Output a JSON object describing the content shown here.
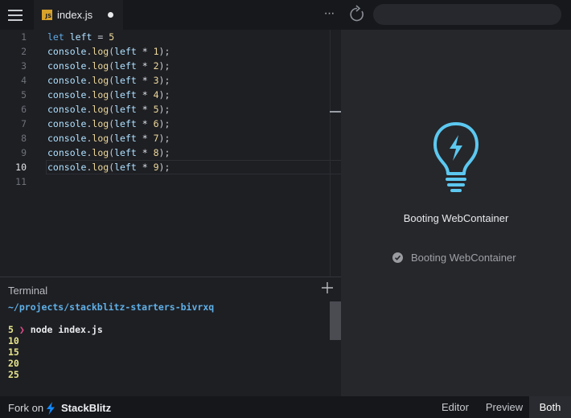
{
  "tab": {
    "filename": "index.js",
    "js_badge": "JS"
  },
  "toolbar": {
    "more": "···"
  },
  "editor": {
    "active_line": 10,
    "line_numbers": [
      "1",
      "2",
      "3",
      "4",
      "5",
      "6",
      "7",
      "8",
      "9",
      "10",
      "11"
    ],
    "lines": [
      [
        [
          "kw",
          "let"
        ],
        [
          "pn",
          " "
        ],
        [
          "id",
          "left"
        ],
        [
          "pn",
          " = "
        ],
        [
          "fn",
          "5"
        ]
      ],
      [
        [
          "id",
          "console"
        ],
        [
          "pn",
          "."
        ],
        [
          "fn",
          "log"
        ],
        [
          "pn",
          "("
        ],
        [
          "id",
          "left"
        ],
        [
          "op",
          " * "
        ],
        [
          "fn",
          "1"
        ],
        [
          "pn",
          ");"
        ]
      ],
      [
        [
          "id",
          "console"
        ],
        [
          "pn",
          "."
        ],
        [
          "fn",
          "log"
        ],
        [
          "pn",
          "("
        ],
        [
          "id",
          "left"
        ],
        [
          "op",
          " * "
        ],
        [
          "fn",
          "2"
        ],
        [
          "pn",
          ");"
        ]
      ],
      [
        [
          "id",
          "console"
        ],
        [
          "pn",
          "."
        ],
        [
          "fn",
          "log"
        ],
        [
          "pn",
          "("
        ],
        [
          "id",
          "left"
        ],
        [
          "op",
          " * "
        ],
        [
          "fn",
          "3"
        ],
        [
          "pn",
          ");"
        ]
      ],
      [
        [
          "id",
          "console"
        ],
        [
          "pn",
          "."
        ],
        [
          "fn",
          "log"
        ],
        [
          "pn",
          "("
        ],
        [
          "id",
          "left"
        ],
        [
          "op",
          " * "
        ],
        [
          "fn",
          "4"
        ],
        [
          "pn",
          ");"
        ]
      ],
      [
        [
          "id",
          "console"
        ],
        [
          "pn",
          "."
        ],
        [
          "fn",
          "log"
        ],
        [
          "pn",
          "("
        ],
        [
          "id",
          "left"
        ],
        [
          "op",
          " * "
        ],
        [
          "fn",
          "5"
        ],
        [
          "pn",
          ");"
        ]
      ],
      [
        [
          "id",
          "console"
        ],
        [
          "pn",
          "."
        ],
        [
          "fn",
          "log"
        ],
        [
          "pn",
          "("
        ],
        [
          "id",
          "left"
        ],
        [
          "op",
          " * "
        ],
        [
          "fn",
          "6"
        ],
        [
          "pn",
          ");"
        ]
      ],
      [
        [
          "id",
          "console"
        ],
        [
          "pn",
          "."
        ],
        [
          "fn",
          "log"
        ],
        [
          "pn",
          "("
        ],
        [
          "id",
          "left"
        ],
        [
          "op",
          " * "
        ],
        [
          "fn",
          "7"
        ],
        [
          "pn",
          ");"
        ]
      ],
      [
        [
          "id",
          "console"
        ],
        [
          "pn",
          "."
        ],
        [
          "fn",
          "log"
        ],
        [
          "pn",
          "("
        ],
        [
          "id",
          "left"
        ],
        [
          "op",
          " * "
        ],
        [
          "fn",
          "8"
        ],
        [
          "pn",
          ");"
        ]
      ],
      [
        [
          "id",
          "console"
        ],
        [
          "pn",
          "."
        ],
        [
          "fn",
          "log"
        ],
        [
          "pn",
          "("
        ],
        [
          "id",
          "left"
        ],
        [
          "op",
          " * "
        ],
        [
          "fn",
          "9"
        ],
        [
          "pn",
          ");"
        ]
      ],
      []
    ]
  },
  "terminal": {
    "title": "Terminal",
    "path": "~/projects/stackblitz-starters-bivrxq",
    "prompt_symbol": "❯",
    "command": "node index.js",
    "output": [
      "5",
      "10",
      "15",
      "20",
      "25"
    ]
  },
  "preview": {
    "title": "Booting WebContainer",
    "status": "Booting WebContainer"
  },
  "footer": {
    "fork_text": "Fork on",
    "brand": "StackBlitz",
    "views": {
      "editor": "Editor",
      "preview": "Preview",
      "both": "Both"
    },
    "active_view": "Both"
  },
  "colors": {
    "accent_cyan": "#5cc8f0",
    "js_badge": "#d8a32a",
    "terminal_path": "#5fb0e8",
    "terminal_prompt": "#e04a8a",
    "terminal_output": "#e7e48a",
    "brand_bolt": "#1389fd"
  },
  "icons": [
    "menu-icon",
    "js-file-icon",
    "unsaved-dot-icon",
    "more-icon",
    "reload-icon",
    "plus-icon",
    "lightbulb-bolt-icon",
    "check-circle-icon",
    "bolt-icon"
  ]
}
